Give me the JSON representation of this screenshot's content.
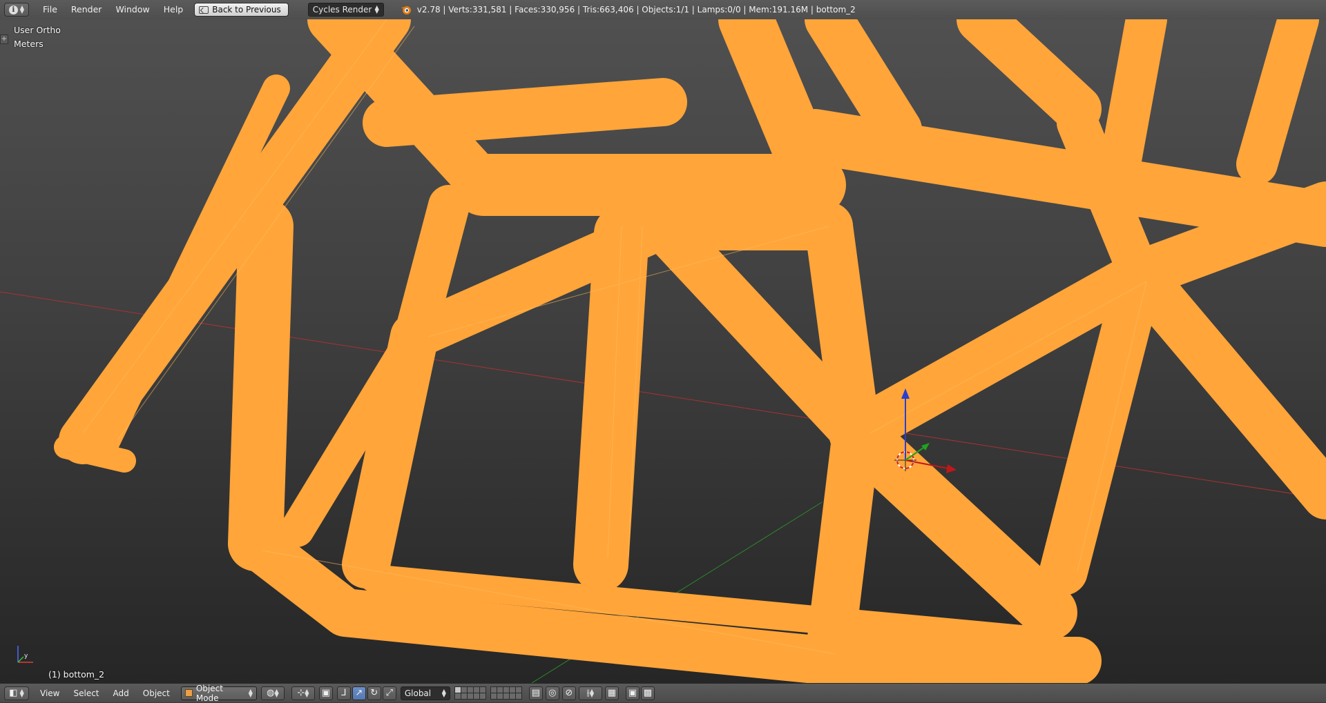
{
  "top_header": {
    "menus": [
      "File",
      "Render",
      "Window",
      "Help"
    ],
    "back_button": "Back to Previous",
    "render_engine": "Cycles Render",
    "stats": "v2.78 | Verts:331,581 | Faces:330,956 | Tris:663,406 | Objects:1/1 | Lamps:0/0 | Mem:191.16M | bottom_2"
  },
  "viewport": {
    "view_label": "User Ortho",
    "unit_label": "Meters",
    "object_label": "(1) bottom_2",
    "mesh_color": "#ffa53a",
    "x_axis_color": "#b03030",
    "y_axis_color": "#2d8a2d"
  },
  "bottom_header": {
    "menus": [
      "View",
      "Select",
      "Add",
      "Object"
    ],
    "mode": "Object Mode",
    "transform_orientation": "Global",
    "icons": [
      "viewport-shading-icon",
      "pivot-icon",
      "manipulator-icon",
      "translate-icon",
      "rotate-icon",
      "scale-icon",
      "layers",
      "lock-icon",
      "proportional-icon",
      "snap-icon",
      "render-icon"
    ]
  }
}
